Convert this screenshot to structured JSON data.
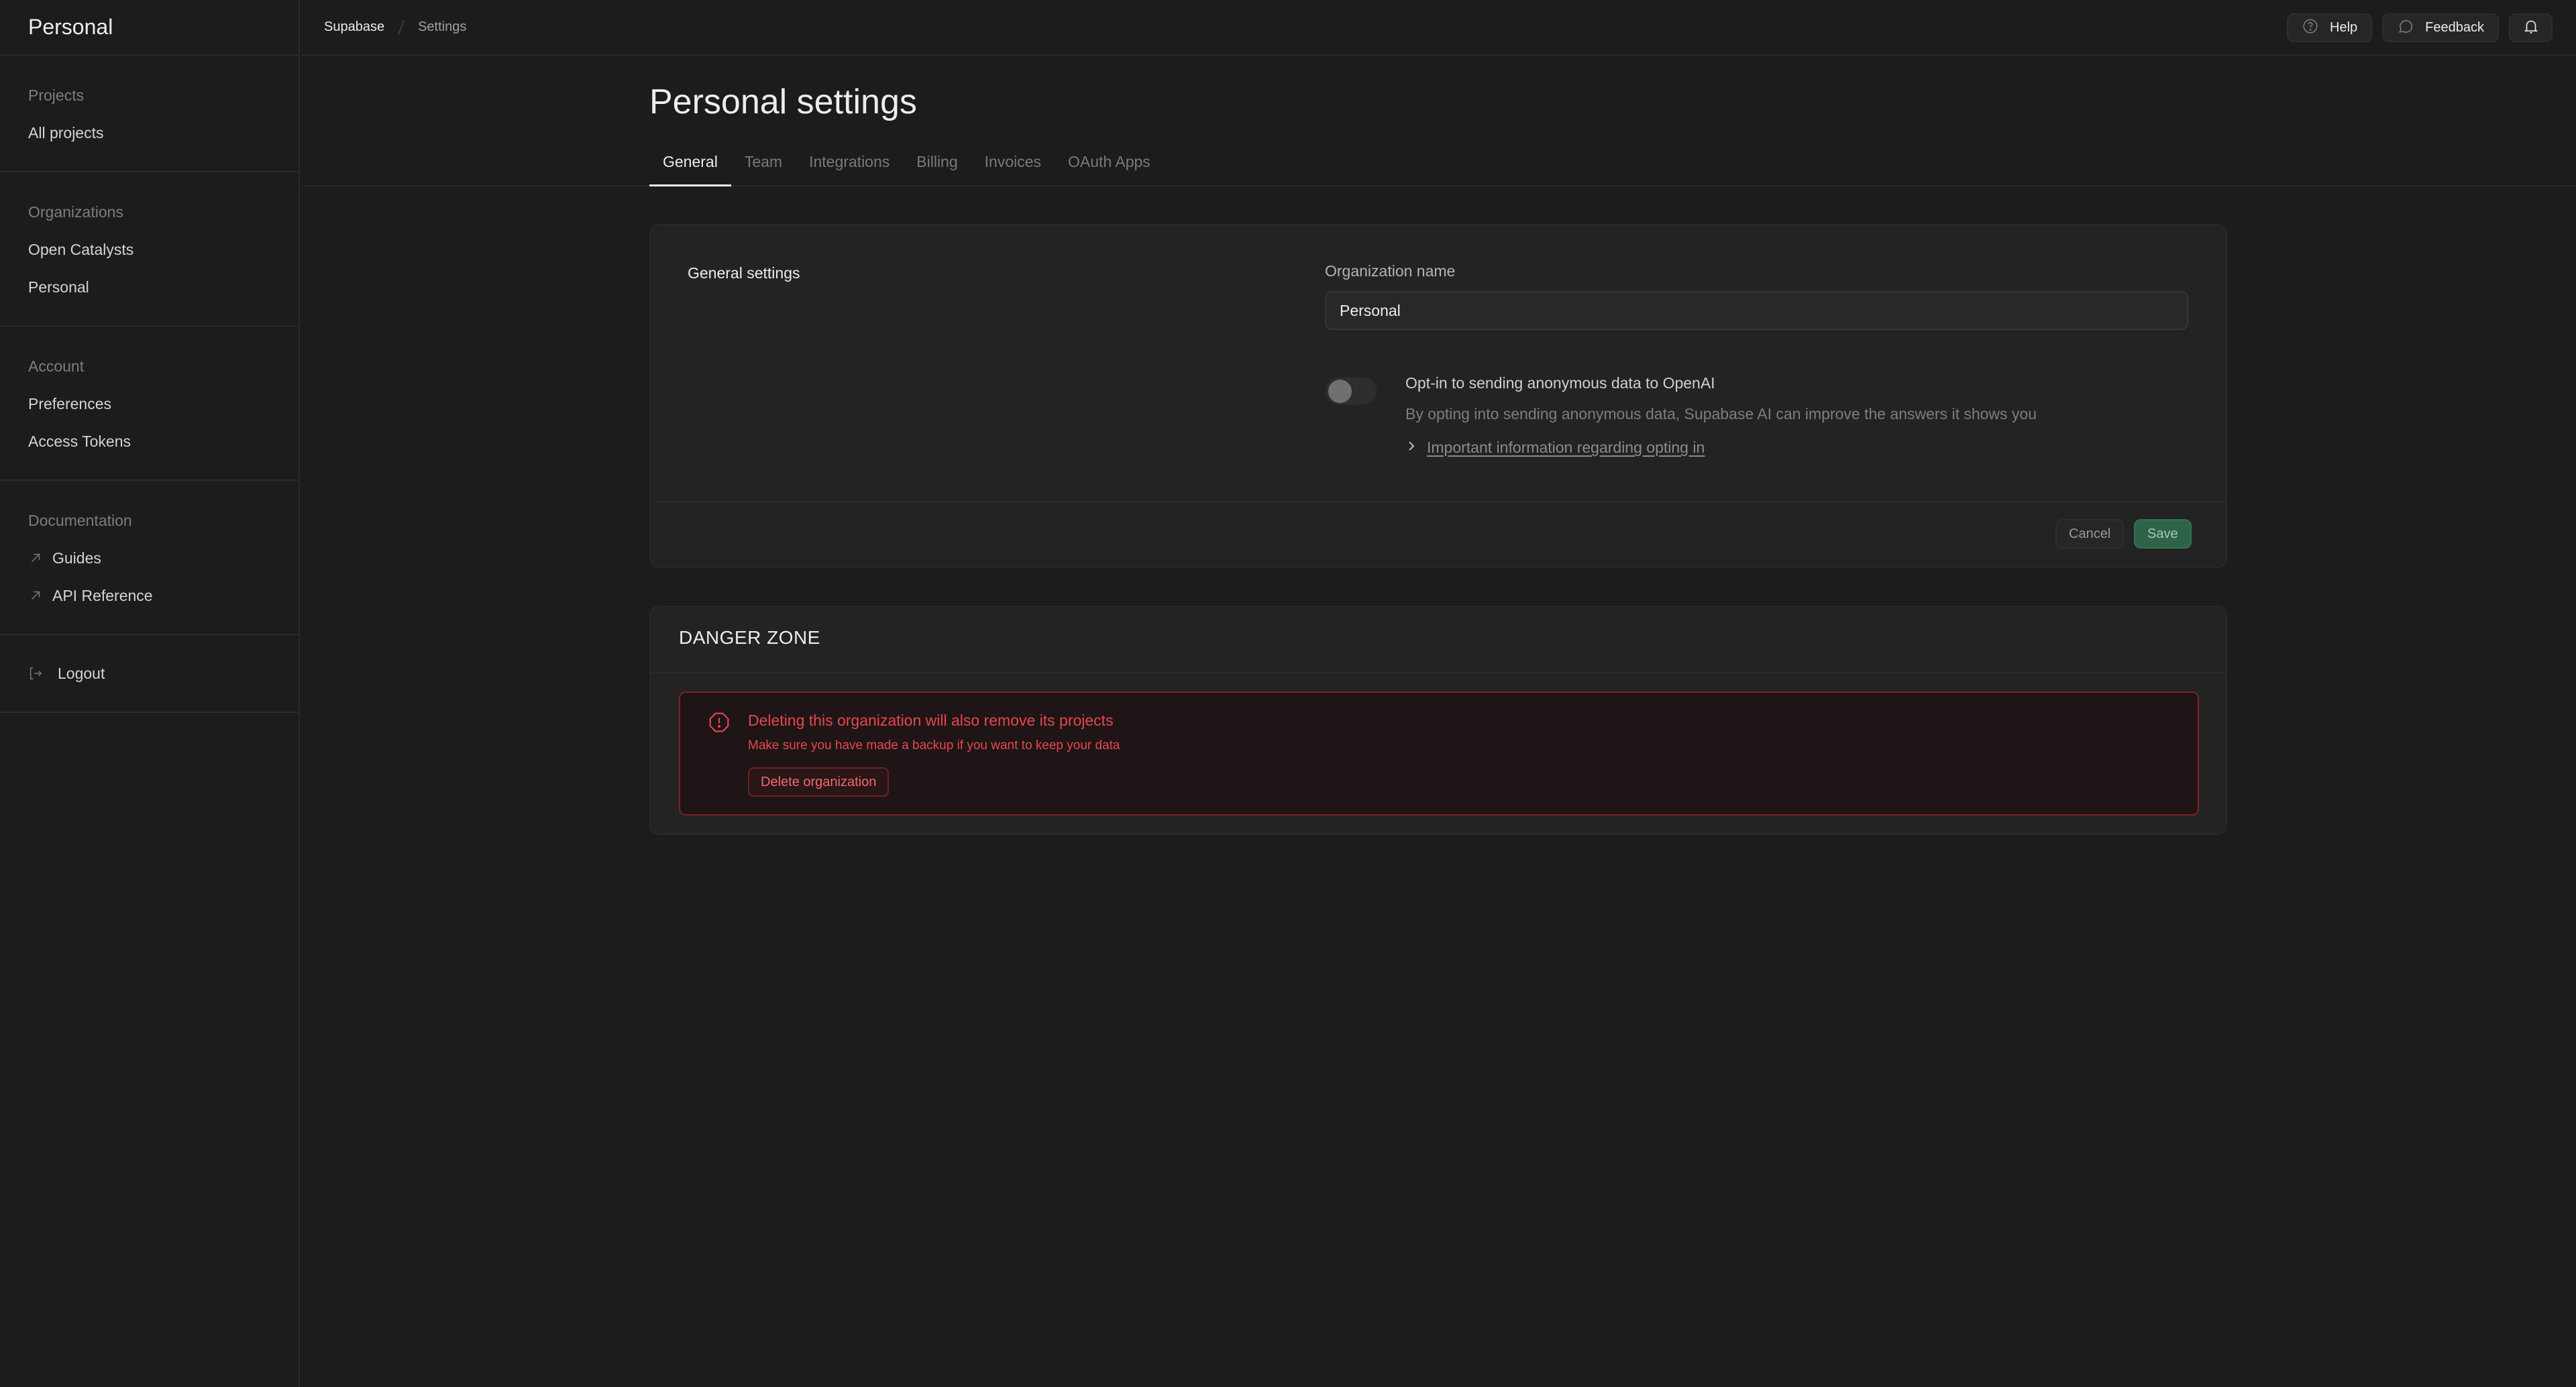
{
  "sidebar": {
    "title": "Personal",
    "sections": [
      {
        "label": "Projects",
        "items": [
          {
            "label": "All projects"
          }
        ]
      },
      {
        "label": "Organizations",
        "items": [
          {
            "label": "Open Catalysts"
          },
          {
            "label": "Personal"
          }
        ]
      },
      {
        "label": "Account",
        "items": [
          {
            "label": "Preferences"
          },
          {
            "label": "Access Tokens"
          }
        ]
      },
      {
        "label": "Documentation",
        "items": [
          {
            "label": "Guides",
            "icon": "external-link-icon"
          },
          {
            "label": "API Reference",
            "icon": "external-link-icon"
          }
        ]
      }
    ],
    "logout": {
      "label": "Logout",
      "icon": "logout-icon"
    }
  },
  "header": {
    "breadcrumb": [
      "Supabase",
      "Settings"
    ],
    "help_label": "Help",
    "feedback_label": "Feedback",
    "notifications_icon": "bell-icon"
  },
  "main": {
    "title": "Personal settings",
    "tabs": [
      {
        "label": "General",
        "active": true
      },
      {
        "label": "Team"
      },
      {
        "label": "Integrations"
      },
      {
        "label": "Billing"
      },
      {
        "label": "Invoices"
      },
      {
        "label": "OAuth Apps"
      }
    ],
    "general": {
      "section_label": "General settings",
      "org_name_label": "Organization name",
      "org_name_value": "Personal",
      "opt_in_enabled": false,
      "opt_in_title": "Opt-in to sending anonymous data to OpenAI",
      "opt_in_description": "By opting into sending anonymous data, Supabase AI can improve the answers it shows you",
      "opt_in_link": "Important information regarding opting in",
      "cancel_label": "Cancel",
      "save_label": "Save"
    },
    "danger": {
      "title": "DANGER ZONE",
      "alert_title": "Deleting this organization will also remove its projects",
      "alert_description": "Make sure you have made a backup if you want to keep your data",
      "delete_label": "Delete organization"
    }
  },
  "colors": {
    "background": "#1c1c1c",
    "card": "#232323",
    "accent_green": "#2d6449",
    "danger_red": "#e5484d"
  }
}
